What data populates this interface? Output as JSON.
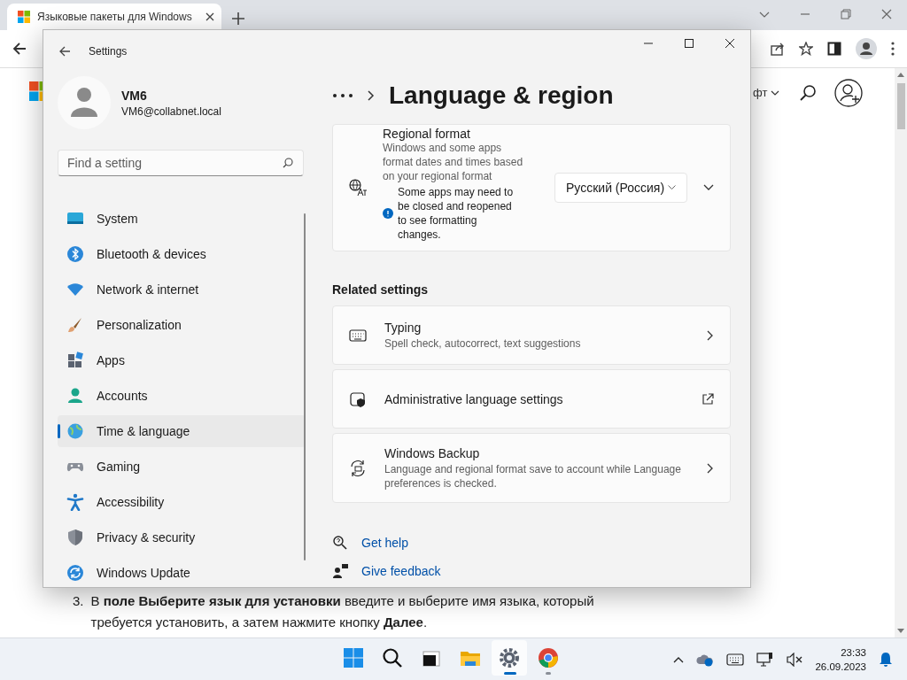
{
  "browser": {
    "tab": {
      "title": "Языковые пакеты для Windows"
    },
    "page": {
      "menu_label": "фт",
      "list_number": "3.",
      "paragraph": "В **поле Выберите язык для установки** введите и выберите имя языка, который требуется установить, а затем нажмите кнопку **Далее**."
    }
  },
  "settings": {
    "title": "Settings",
    "user": {
      "name": "VM6",
      "email": "VM6@collabnet.local"
    },
    "search": {
      "placeholder": "Find a setting"
    },
    "nav": [
      {
        "label": "System",
        "selected": false
      },
      {
        "label": "Bluetooth & devices",
        "selected": false
      },
      {
        "label": "Network & internet",
        "selected": false
      },
      {
        "label": "Personalization",
        "selected": false
      },
      {
        "label": "Apps",
        "selected": false
      },
      {
        "label": "Accounts",
        "selected": false
      },
      {
        "label": "Time & language",
        "selected": true
      },
      {
        "label": "Gaming",
        "selected": false
      },
      {
        "label": "Accessibility",
        "selected": false
      },
      {
        "label": "Privacy & security",
        "selected": false
      },
      {
        "label": "Windows Update",
        "selected": false
      }
    ],
    "heading": "Language & region",
    "regional_format": {
      "title": "Regional format",
      "description": "Windows and some apps format dates and times based on your regional format",
      "note": "Some apps may need to be closed and reopened to see formatting changes.",
      "value": "Русский (Россия)"
    },
    "related_title": "Related settings",
    "related": [
      {
        "title": "Typing",
        "description": "Spell check, autocorrect, text suggestions",
        "kind": "chevron"
      },
      {
        "title": "Administrative language settings",
        "kind": "external"
      },
      {
        "title": "Windows Backup",
        "description": "Language and regional format save to account while Language preferences is checked.",
        "kind": "chevron"
      }
    ],
    "links": [
      {
        "label": "Get help"
      },
      {
        "label": "Give feedback"
      }
    ]
  },
  "taskbar": {
    "apps": [
      {
        "active": false,
        "running": false
      },
      {
        "active": false,
        "running": false
      },
      {
        "active": false,
        "running": false
      },
      {
        "active": false,
        "running": false
      },
      {
        "active": true,
        "running": true
      },
      {
        "active": false,
        "running": true
      }
    ],
    "time": "23:33",
    "date": "26.09.2023"
  }
}
